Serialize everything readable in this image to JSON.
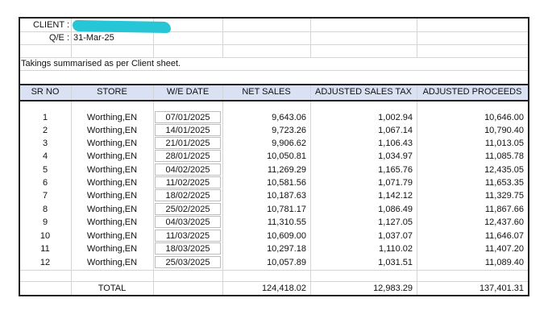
{
  "meta": {
    "client_label": "CLIENT :",
    "qe_label": "Q/E :",
    "qe_value": "31-Mar-25",
    "note": "Takings summarised as per Client sheet."
  },
  "columns": {
    "sr_no": "SR NO",
    "store": "STORE",
    "we_date": "W/E DATE",
    "net_sales": "NET SALES",
    "adjusted_sales_tax": "ADJUSTED SALES TAX",
    "adjusted_proceeds": "ADJUSTED PROCEEDS"
  },
  "rows": [
    {
      "sr": "1",
      "store": "Worthing,EN",
      "date": "07/01/2025",
      "net": "9,643.06",
      "tax": "1,002.94",
      "proceeds": "10,646.00"
    },
    {
      "sr": "2",
      "store": "Worthing,EN",
      "date": "14/01/2025",
      "net": "9,723.26",
      "tax": "1,067.14",
      "proceeds": "10,790.40"
    },
    {
      "sr": "3",
      "store": "Worthing,EN",
      "date": "21/01/2025",
      "net": "9,906.62",
      "tax": "1,106.43",
      "proceeds": "11,013.05"
    },
    {
      "sr": "4",
      "store": "Worthing,EN",
      "date": "28/01/2025",
      "net": "10,050.81",
      "tax": "1,034.97",
      "proceeds": "11,085.78"
    },
    {
      "sr": "5",
      "store": "Worthing,EN",
      "date": "04/02/2025",
      "net": "11,269.29",
      "tax": "1,165.76",
      "proceeds": "12,435.05"
    },
    {
      "sr": "6",
      "store": "Worthing,EN",
      "date": "11/02/2025",
      "net": "10,581.56",
      "tax": "1,071.79",
      "proceeds": "11,653.35"
    },
    {
      "sr": "7",
      "store": "Worthing,EN",
      "date": "18/02/2025",
      "net": "10,187.63",
      "tax": "1,142.12",
      "proceeds": "11,329.75"
    },
    {
      "sr": "8",
      "store": "Worthing,EN",
      "date": "25/02/2025",
      "net": "10,781.17",
      "tax": "1,086.49",
      "proceeds": "11,867.66"
    },
    {
      "sr": "9",
      "store": "Worthing,EN",
      "date": "04/03/2025",
      "net": "11,310.55",
      "tax": "1,127.05",
      "proceeds": "12,437.60"
    },
    {
      "sr": "10",
      "store": "Worthing,EN",
      "date": "11/03/2025",
      "net": "10,609.00",
      "tax": "1,037.07",
      "proceeds": "11,646.07"
    },
    {
      "sr": "11",
      "store": "Worthing,EN",
      "date": "18/03/2025",
      "net": "10,297.18",
      "tax": "1,110.02",
      "proceeds": "11,407.20"
    },
    {
      "sr": "12",
      "store": "Worthing,EN",
      "date": "25/03/2025",
      "net": "10,057.89",
      "tax": "1,031.51",
      "proceeds": "11,089.40"
    }
  ],
  "totals": {
    "label": "TOTAL",
    "net": "124,418.02",
    "tax": "12,983.29",
    "proceeds": "137,401.31"
  },
  "colors": {
    "header_band": "#d9e1f2",
    "redaction": "#26c6d6",
    "grid": "#d4d4d4",
    "border": "#222222"
  }
}
